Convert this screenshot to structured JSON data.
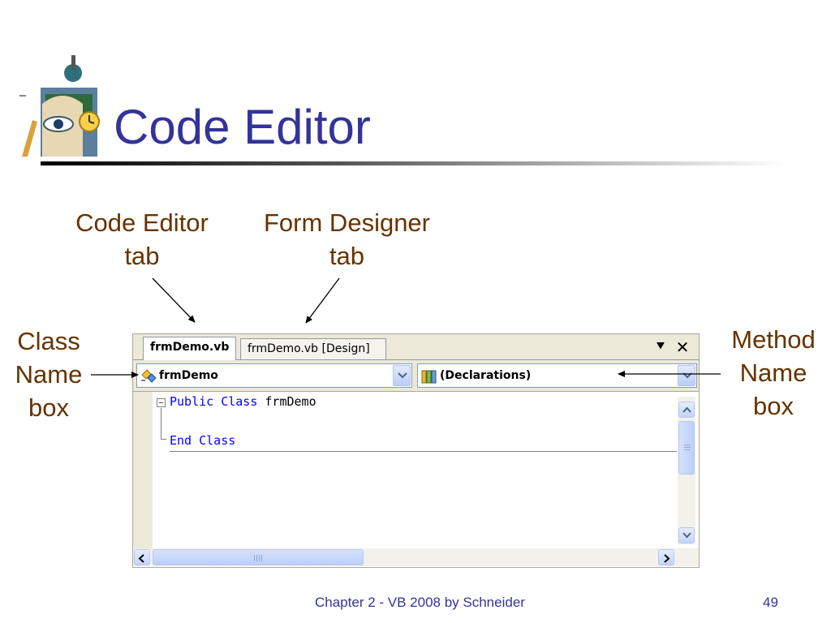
{
  "slide": {
    "title": "Code Editor",
    "footer": "Chapter 2 - VB 2008 by Schneider",
    "page_number": "49"
  },
  "annotations": {
    "code_editor_tab": [
      "Code Editor",
      "tab"
    ],
    "form_designer_tab": [
      "Form Designer",
      "tab"
    ],
    "class_name_box": [
      "Class",
      "Name",
      "box"
    ],
    "method_name_box": [
      "Method",
      "Name",
      "box"
    ]
  },
  "editor": {
    "tabs": [
      {
        "label": "frmDemo.vb",
        "active": true
      },
      {
        "label": "frmDemo.vb [Design]",
        "active": false
      }
    ],
    "window_controls": {
      "dropdown_glyph": "⯆",
      "close_glyph": "✕"
    },
    "class_combo": {
      "value": "frmDemo",
      "icon": "class-icon"
    },
    "method_combo": {
      "value": "(Declarations)",
      "icon": "declarations-icon"
    },
    "code": {
      "line1": {
        "keyword": "Public Class",
        "name": "frmDemo"
      },
      "line2": {
        "keyword": "End Class"
      },
      "outline_glyph": "−"
    }
  },
  "colors": {
    "title": "#333399",
    "annotation": "#663300",
    "keyword": "#0000ff",
    "footer": "#333399"
  }
}
